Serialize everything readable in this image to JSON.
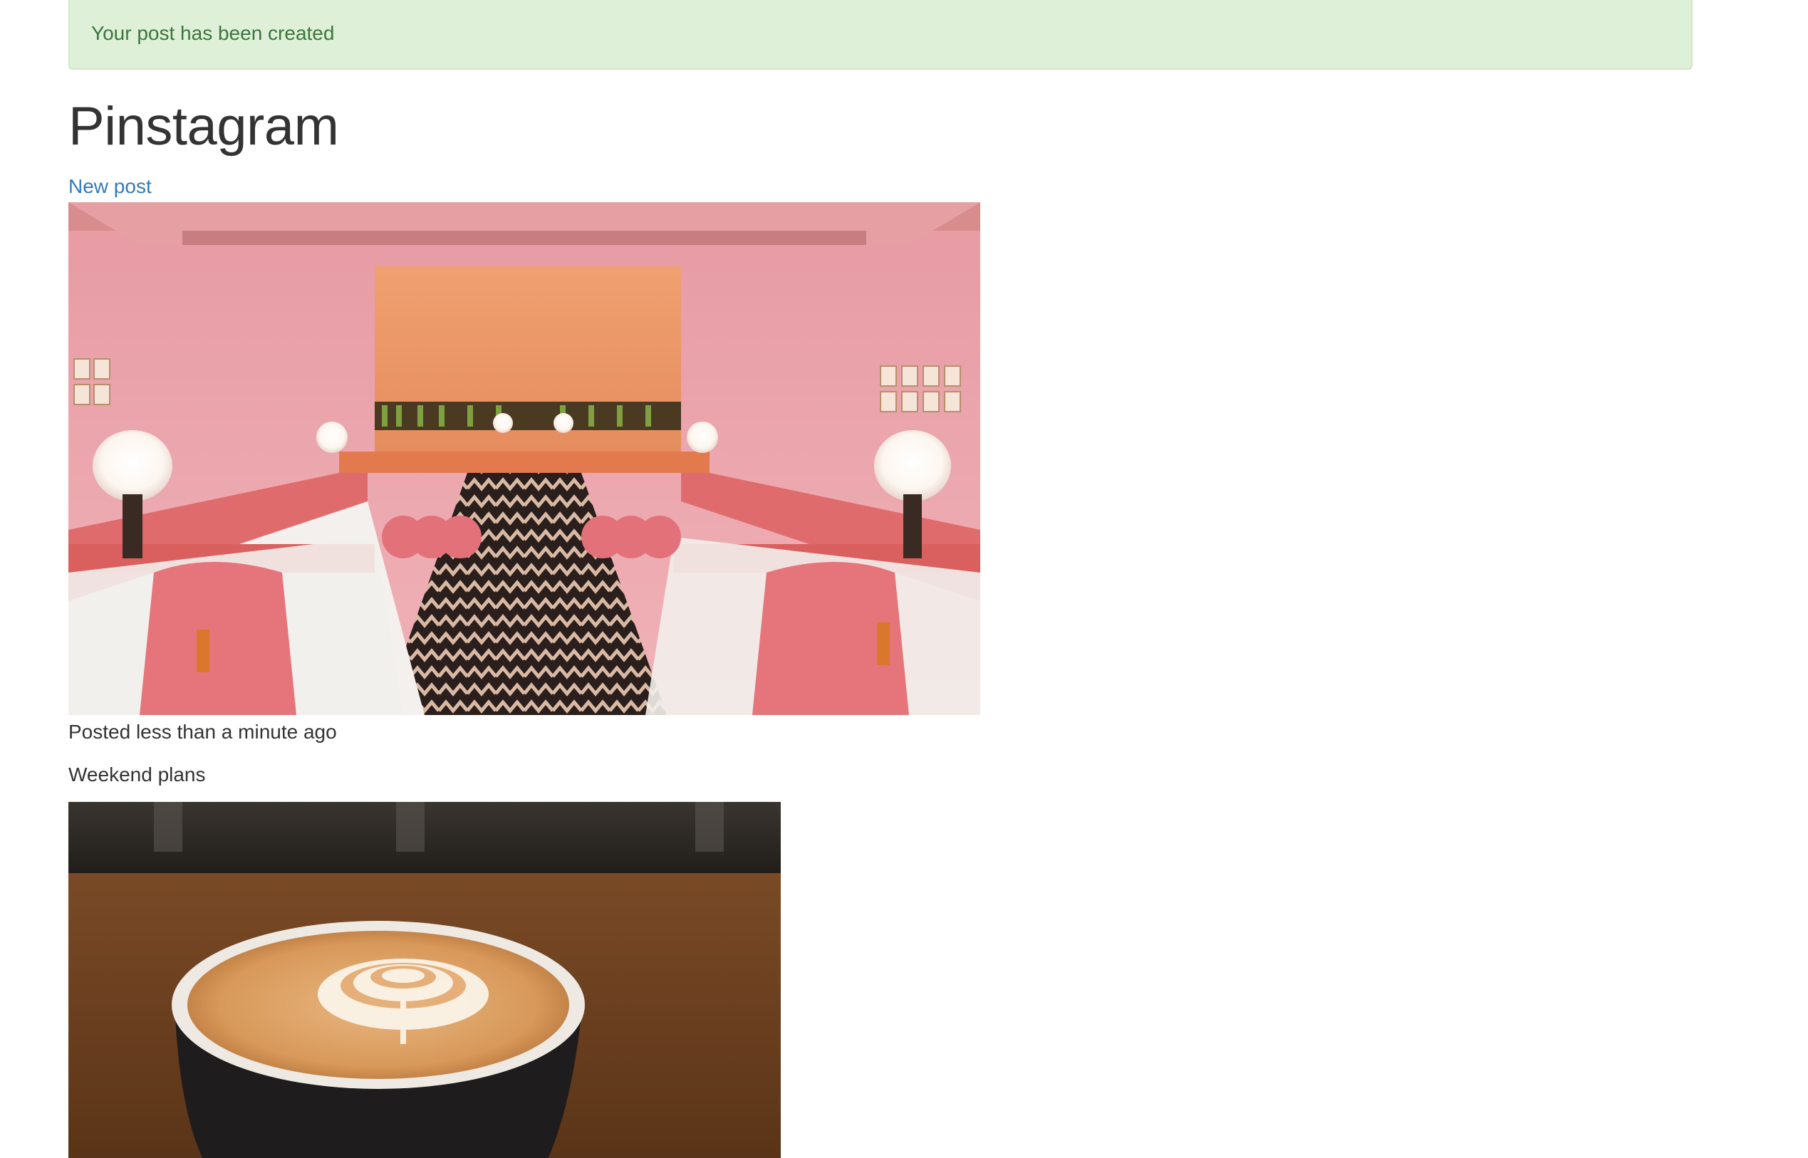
{
  "flash": {
    "message": "Your post has been created"
  },
  "header": {
    "title": "Pinstagram",
    "new_post_label": "New post"
  },
  "posts": [
    {
      "image_subject": "pink-restaurant-interior",
      "posted_text": "Posted less than a minute ago",
      "caption": "Weekend plans"
    },
    {
      "image_subject": "latte-art-coffee-cup"
    }
  ],
  "colors": {
    "alert_bg": "#dff0d8",
    "alert_text": "#3c763d",
    "link": "#337ab7",
    "text": "#333333"
  }
}
